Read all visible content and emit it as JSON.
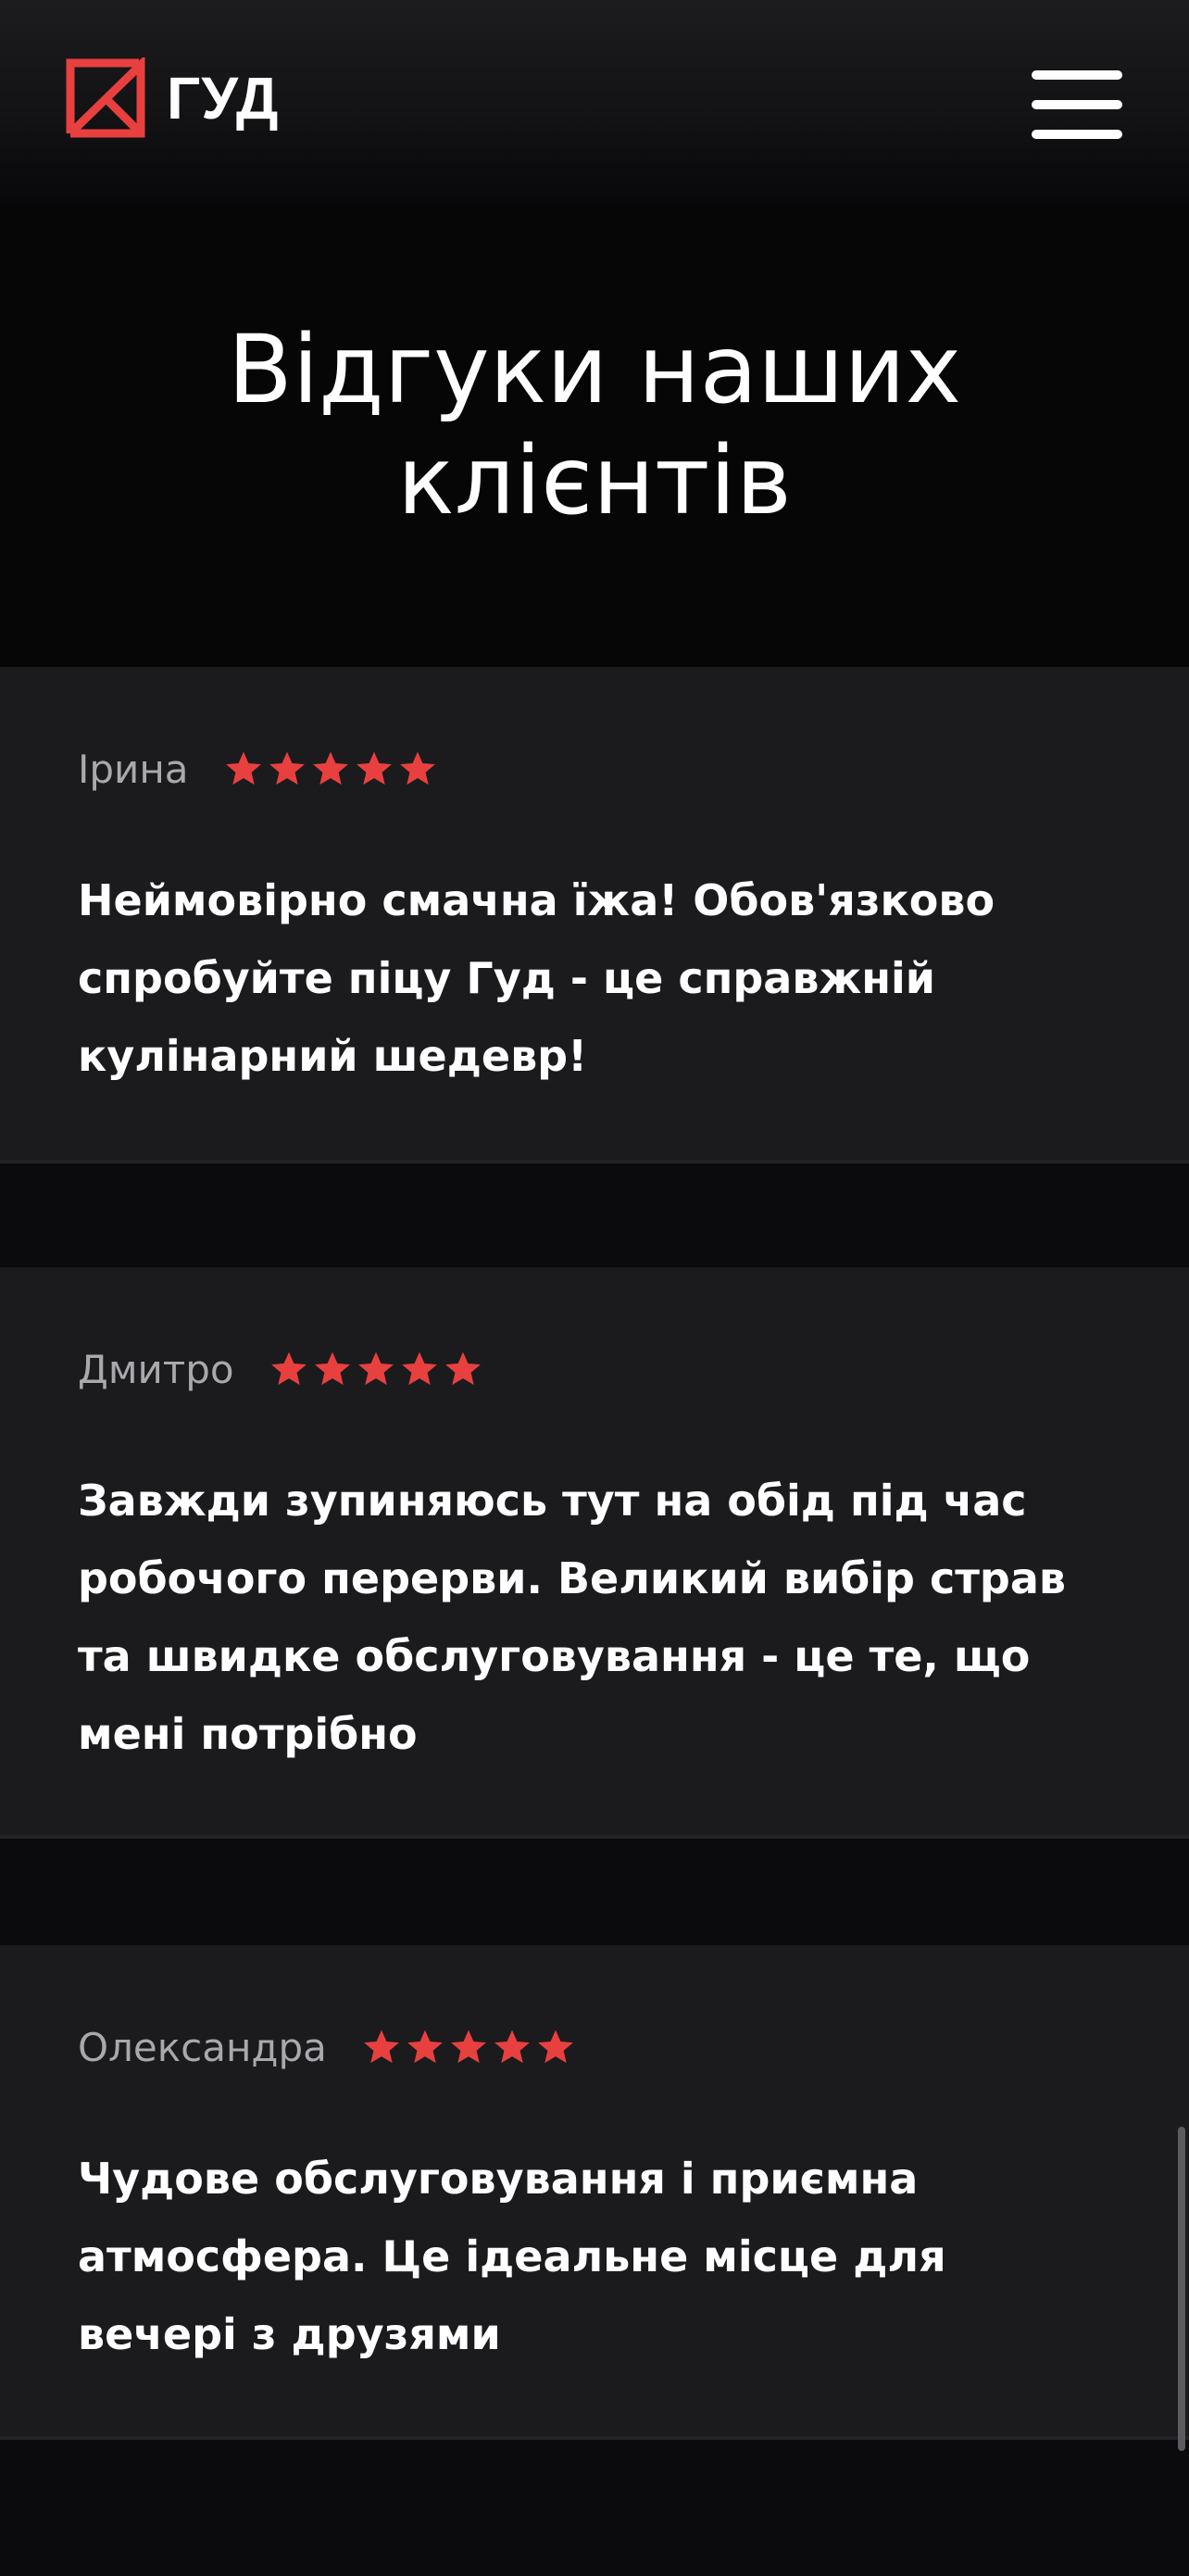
{
  "header": {
    "brand": "ГУД",
    "logo_icon": "gud-logo-icon",
    "menu_icon": "hamburger-menu-icon",
    "accent_color": "#e8403f"
  },
  "hero": {
    "title": "Відгуки наших клієнтів"
  },
  "reviews": [
    {
      "name": "Ірина",
      "rating": 5,
      "text": "Неймовірно смачна їжа! Обов'язково спробуйте піцу Гуд - це справжній кулінарний шедевр!"
    },
    {
      "name": "Дмитро",
      "rating": 5,
      "text": "Завжди зупиняюсь тут на обід під час робочого перерви. Великий вибір страв та швидке обслуговування - це те, що мені потрібно"
    },
    {
      "name": "Олександра",
      "rating": 5,
      "text": "Чудове обслуговування і приємна атмосфера. Це ідеальне місце для вечері з друзями"
    }
  ],
  "colors": {
    "star": "#e8403f",
    "card_background": "#1b1b1e",
    "page_background": "#0b0b0d"
  }
}
